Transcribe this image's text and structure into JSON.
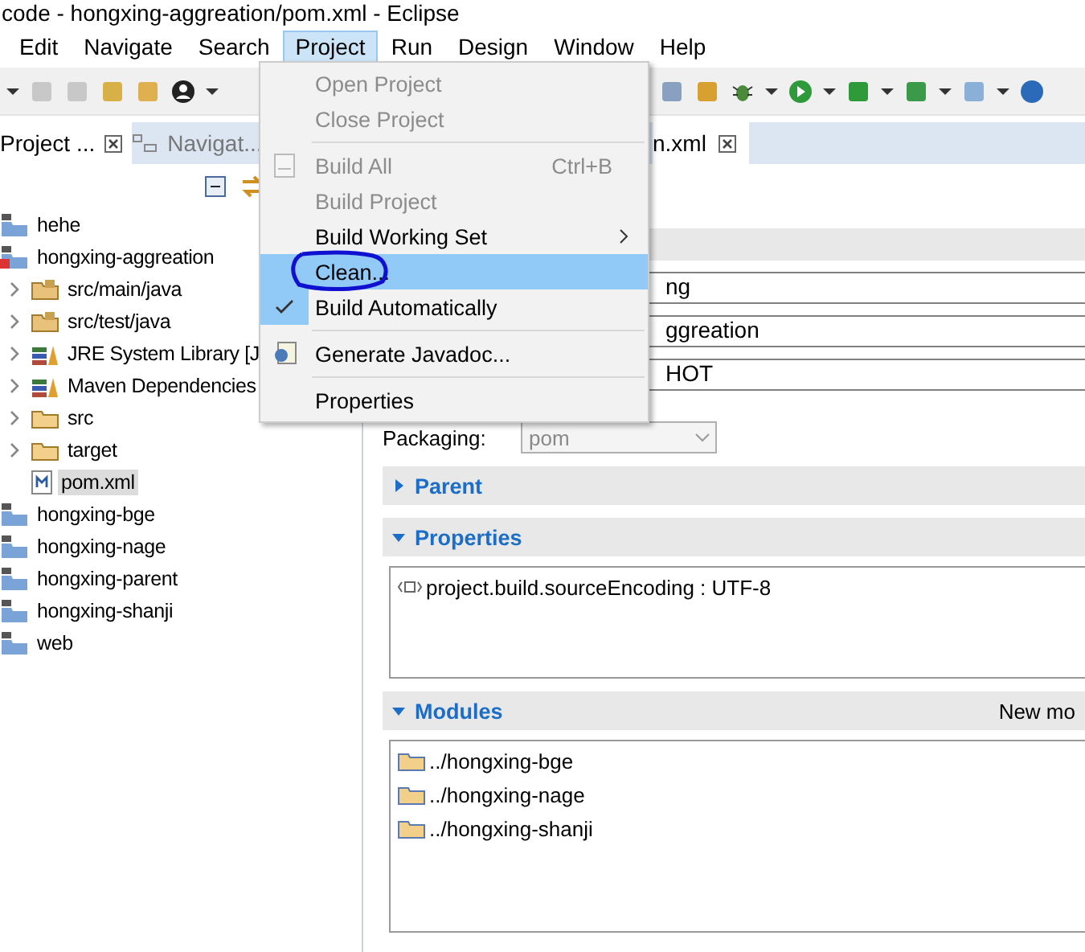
{
  "window": {
    "title": "code - hongxing-aggreation/pom.xml - Eclipse"
  },
  "menu_bar": [
    {
      "label": "Edit",
      "selected": false
    },
    {
      "label": "Navigate",
      "selected": false
    },
    {
      "label": "Search",
      "selected": false
    },
    {
      "label": "Project",
      "selected": true
    },
    {
      "label": "Run",
      "selected": false
    },
    {
      "label": "Design",
      "selected": false
    },
    {
      "label": "Window",
      "selected": false
    },
    {
      "label": "Help",
      "selected": false
    }
  ],
  "view_tabs": [
    {
      "label": "Project ...",
      "selected": true
    },
    {
      "label": "Navigat...",
      "selected": false
    }
  ],
  "project_tree": [
    {
      "label": "hehe",
      "kind": "project",
      "error": false
    },
    {
      "label": "hongxing-aggreation",
      "kind": "project",
      "error": true,
      "children": [
        {
          "label": "src/main/java",
          "kind": "package-folder",
          "expanded": false,
          "selected": false
        },
        {
          "label": "src/test/java",
          "kind": "package-folder",
          "expanded": false,
          "selected": false
        },
        {
          "label": "JRE System Library [J",
          "kind": "library",
          "expanded": false,
          "selected": false
        },
        {
          "label": "Maven Dependencies",
          "kind": "library",
          "expanded": false,
          "selected": false
        },
        {
          "label": "src",
          "kind": "folder",
          "expanded": false,
          "selected": false
        },
        {
          "label": "target",
          "kind": "folder",
          "expanded": false,
          "selected": false
        },
        {
          "label": "pom.xml",
          "kind": "file",
          "selected": true
        }
      ]
    },
    {
      "label": "hongxing-bge",
      "kind": "project",
      "error": false
    },
    {
      "label": "hongxing-nage",
      "kind": "project",
      "error": false
    },
    {
      "label": "hongxing-parent",
      "kind": "project",
      "error": false
    },
    {
      "label": "hongxing-shanji",
      "kind": "project",
      "error": false
    },
    {
      "label": "web",
      "kind": "project",
      "error": false
    }
  ],
  "project_menu": [
    {
      "kind": "item",
      "label": "Open Project",
      "disabled": true,
      "selected": false,
      "checked": false
    },
    {
      "kind": "item",
      "label": "Close Project",
      "disabled": true,
      "selected": false,
      "checked": false
    },
    {
      "kind": "separator"
    },
    {
      "kind": "item",
      "label": "Build All",
      "shortcut": "Ctrl+B",
      "icon": true,
      "disabled": true,
      "selected": false,
      "checked": false
    },
    {
      "kind": "item",
      "label": "Build Project",
      "disabled": true,
      "selected": false,
      "checked": false
    },
    {
      "kind": "item",
      "label": "Build Working Set",
      "submenu": true,
      "disabled": false,
      "selected": false,
      "checked": false
    },
    {
      "kind": "item",
      "label": "Clean...",
      "disabled": false,
      "selected": true,
      "checked": false,
      "circled": true
    },
    {
      "kind": "item",
      "label": "Build Automatically",
      "disabled": false,
      "selected": false,
      "checked": true
    },
    {
      "kind": "separator"
    },
    {
      "kind": "item",
      "label": "Generate Javadoc...",
      "icon": true,
      "disabled": false,
      "selected": false,
      "checked": false
    },
    {
      "kind": "separator"
    },
    {
      "kind": "item",
      "label": "Properties",
      "disabled": false,
      "selected": false,
      "checked": false
    }
  ],
  "editor": {
    "tab": {
      "label": "n.xml"
    },
    "fields": [
      "ng",
      "ggreation",
      "HOT"
    ],
    "packaging": {
      "label": "Packaging:",
      "value": "pom"
    },
    "sections": [
      {
        "title": "Parent",
        "expanded": false
      },
      {
        "title": "Properties",
        "expanded": true,
        "kind": "property",
        "items": [
          "project.build.sourceEncoding : UTF-8"
        ]
      },
      {
        "title": "Modules",
        "expanded": true,
        "kind": "module",
        "action": "New mo",
        "items": [
          "../hongxing-bge",
          "../hongxing-nage",
          "../hongxing-shanji"
        ]
      }
    ]
  }
}
